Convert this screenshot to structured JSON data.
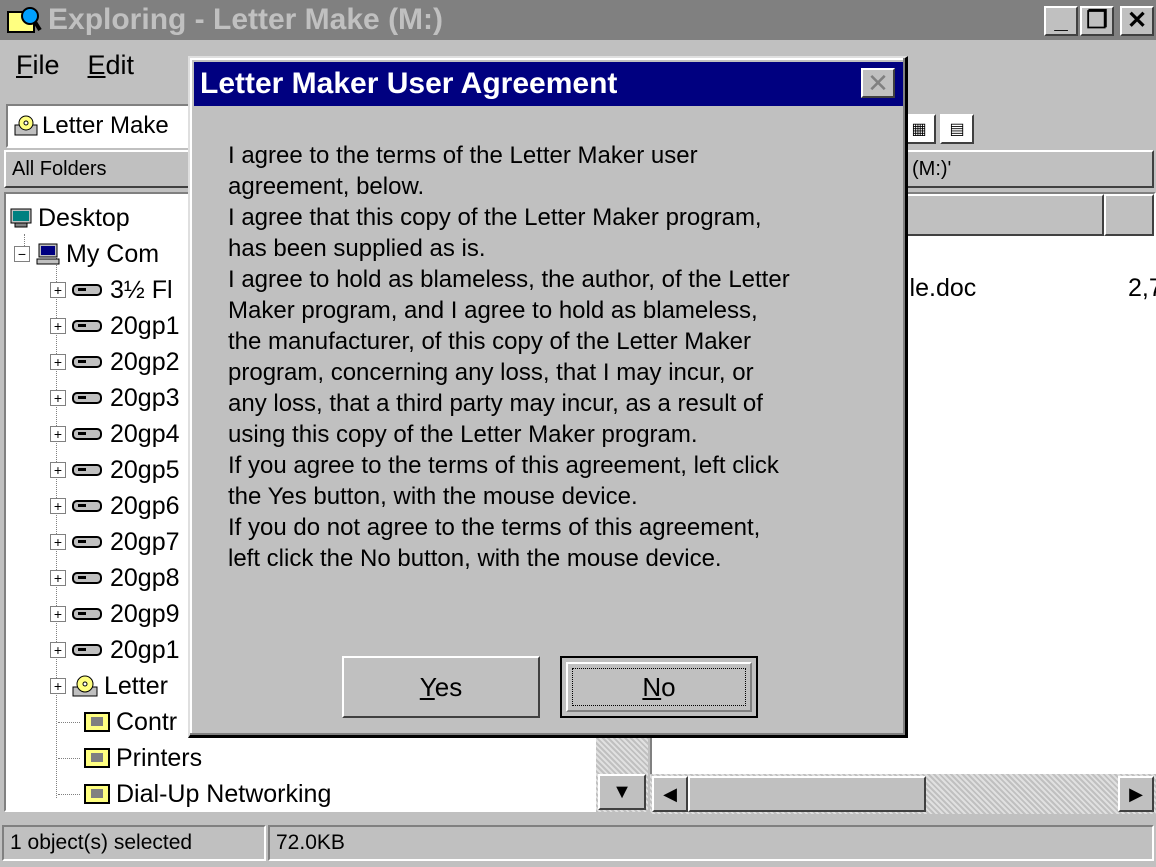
{
  "window": {
    "title": "Exploring - Letter Make (M:)",
    "minimize_icon": "minimize-icon",
    "restore_icon": "restore-icon",
    "close_icon": "close-icon",
    "min_glyph": "_",
    "restore_glyph": "❐",
    "close_glyph": "✕"
  },
  "menu": {
    "file": {
      "accel": "F",
      "rest": "ile"
    },
    "edit": {
      "accel": "E",
      "rest": "dit"
    }
  },
  "address": {
    "value": "Letter Make"
  },
  "panes": {
    "folders_header": "All Folders",
    "contents_header": "(M:)'"
  },
  "tree": [
    {
      "label": "Desktop",
      "icon": "desktop-icon"
    },
    {
      "label": "My Com",
      "icon": "computer-icon"
    },
    {
      "label": "3½ Fl",
      "icon": "floppy-drive-icon"
    },
    {
      "label": "20gp1",
      "icon": "drive-icon"
    },
    {
      "label": "20gp2",
      "icon": "drive-icon"
    },
    {
      "label": "20gp3",
      "icon": "drive-icon"
    },
    {
      "label": "20gp4",
      "icon": "drive-icon"
    },
    {
      "label": "20gp5",
      "icon": "drive-icon"
    },
    {
      "label": "20gp6",
      "icon": "drive-icon"
    },
    {
      "label": "20gp7",
      "icon": "drive-icon"
    },
    {
      "label": "20gp8",
      "icon": "drive-icon"
    },
    {
      "label": "20gp9",
      "icon": "drive-icon"
    },
    {
      "label": "20gp1",
      "icon": "drive-icon"
    },
    {
      "label": "Letter",
      "icon": "cd-drive-icon"
    },
    {
      "label": "Contr",
      "icon": "control-panel-icon"
    },
    {
      "label": "Printers",
      "icon": "printers-icon"
    },
    {
      "label": "Dial-Up Networking",
      "icon": "dialup-icon"
    }
  ],
  "files": [
    {
      "name": "ile.doc",
      "size": "2,7"
    }
  ],
  "status": {
    "selection": "1 object(s) selected",
    "size": "72.0KB"
  },
  "dialog": {
    "title": "Letter Maker User Agreement",
    "close_glyph": "✕",
    "lines": [
      "I agree to the terms of the Letter Maker user",
      "agreement, below.",
      "I agree that this copy of the Letter Maker program,",
      "has been supplied as is.",
      "I agree to hold as blameless, the author, of the Letter",
      "Maker program, and I agree to hold as blameless,",
      "the manufacturer, of this copy of the Letter Maker",
      "program, concerning any loss, that I may incur, or",
      "any loss, that a third party may incur, as a result of",
      "using this copy of the Letter Maker program.",
      "If you agree to the terms of this agreement, left click",
      "the Yes button, with the mouse device.",
      "If you do not agree to the terms of this agreement,",
      "left click the No button, with the mouse device."
    ],
    "yes": {
      "accel": "Y",
      "rest": "es"
    },
    "no": {
      "accel": "N",
      "rest": "o"
    }
  },
  "colors": {
    "face": "#c0c0c0",
    "active_title": "#000080",
    "inactive_title": "#808080"
  }
}
